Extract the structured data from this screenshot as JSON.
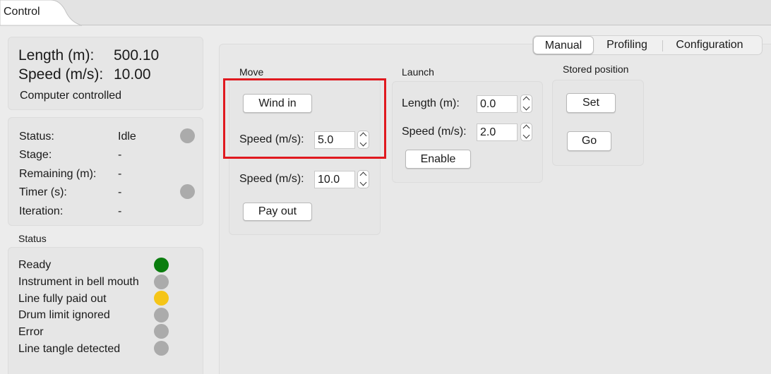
{
  "tabs": {
    "control": "Control"
  },
  "info": {
    "length_label": "Length (m):",
    "length_value": "500.10",
    "speed_label": "Speed (m/s):",
    "speed_value": "10.00",
    "mode": "Computer controlled"
  },
  "stage_info": {
    "rows": [
      {
        "label": "Status:",
        "value": "Idle",
        "indicator": "#ababab"
      },
      {
        "label": "Stage:",
        "value": "-"
      },
      {
        "label": "Remaining (m):",
        "value": "-"
      },
      {
        "label": "Timer (s):",
        "value": "-",
        "indicator": "#ababab"
      },
      {
        "label": "Iteration:",
        "value": "-"
      }
    ]
  },
  "status": {
    "title": "Status",
    "items": [
      {
        "label": "Ready",
        "color": "#0a7d0e"
      },
      {
        "label": "Instrument in bell mouth",
        "color": "#ababab"
      },
      {
        "label": "Line fully paid out",
        "color": "#f5c518"
      },
      {
        "label": "Drum limit ignored",
        "color": "#ababab"
      },
      {
        "label": "Error",
        "color": "#ababab"
      },
      {
        "label": "Line tangle detected",
        "color": "#ababab"
      }
    ]
  },
  "mode_tabs": {
    "selected": "Manual",
    "items": [
      "Manual",
      "Profiling",
      "Configuration"
    ]
  },
  "move": {
    "title": "Move",
    "wind_in_label": "Wind in",
    "wind_speed_label": "Speed (m/s):",
    "wind_speed_value": "5.0",
    "payout_speed_label": "Speed (m/s):",
    "payout_speed_value": "10.0",
    "pay_out_label": "Pay out"
  },
  "launch": {
    "title": "Launch",
    "length_label": "Length (m):",
    "length_value": "0.0",
    "speed_label": "Speed (m/s):",
    "speed_value": "2.0",
    "enable_label": "Enable"
  },
  "stored": {
    "title": "Stored position",
    "set_label": "Set",
    "go_label": "Go"
  },
  "colors": {
    "highlight": "#e0191f"
  }
}
